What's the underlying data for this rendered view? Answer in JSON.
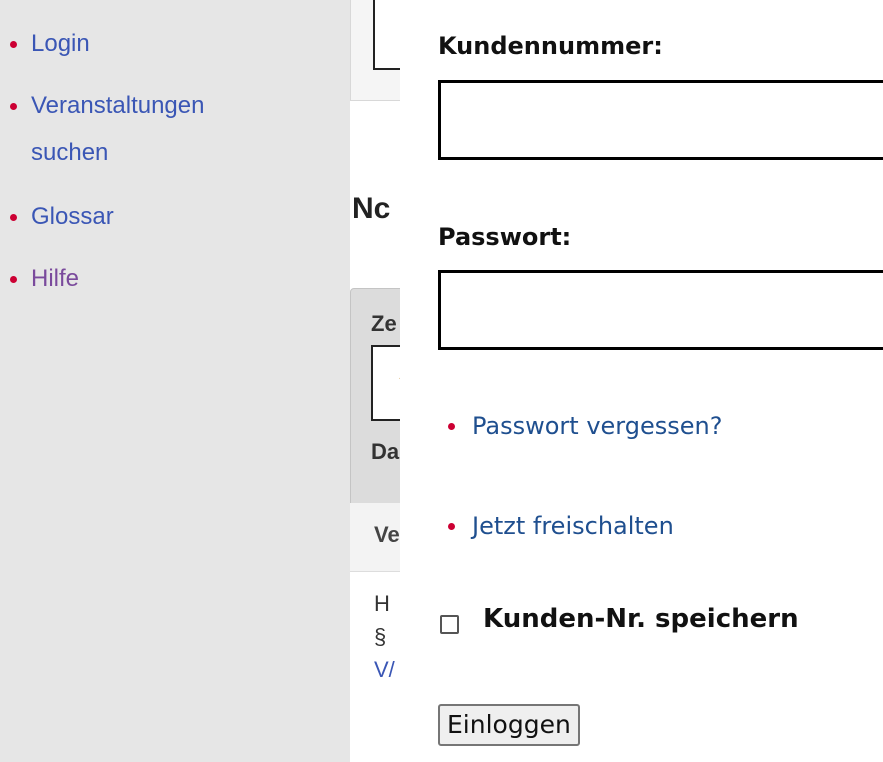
{
  "sidebar": {
    "items": [
      {
        "label": "Login"
      },
      {
        "label_line1": "Veranstaltungen",
        "label_line2": "suchen"
      },
      {
        "label": "Glossar"
      },
      {
        "label": "Hilfe"
      }
    ]
  },
  "middle": {
    "heading": "Nc",
    "panel": {
      "label_top": "Ze",
      "label_bottom": "Da",
      "field_text": "-"
    },
    "subhead": "Ve",
    "body_lines": [
      "H",
      "§",
      "V/"
    ]
  },
  "login": {
    "customer_label": "Kundennummer:",
    "customer_value": "",
    "password_label": "Passwort:",
    "password_value": "",
    "forgot_link": "Passwort vergessen?",
    "activate_link": "Jetzt freischalten",
    "remember_label": "Kunden-Nr. speichern",
    "remember_checked": false,
    "submit_label": "Einloggen"
  },
  "colors": {
    "bullet": "#cc0033",
    "link": "#3a56b5",
    "visited_link": "#7a4a9c",
    "sidebar_bg": "#e6e6e6"
  }
}
